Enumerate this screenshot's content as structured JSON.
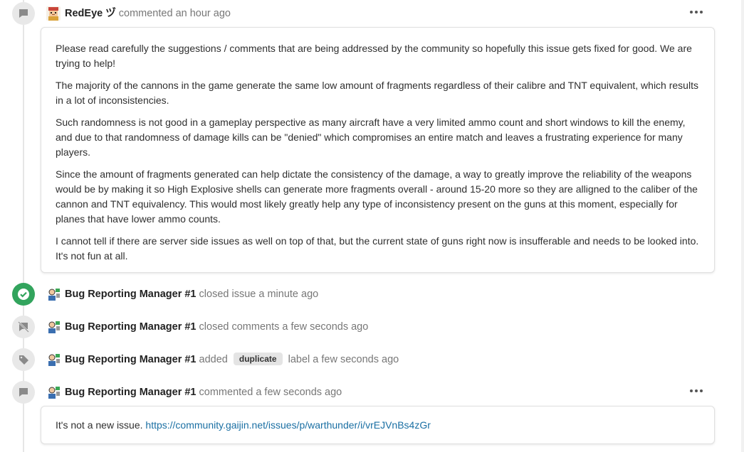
{
  "timeline": [
    {
      "type": "comment",
      "icon": "comment-icon",
      "author": "RedEye ヅ",
      "action": "commented",
      "time": "an hour ago",
      "paragraphs": [
        "Please read carefully the suggestions / comments that are being addressed by the community so hopefully this issue gets fixed for good. We are trying to help!",
        "The majority of the cannons in the game generate the same low amount of fragments regardless of their calibre and TNT equivalent, which results in a lot of inconsistencies.",
        "Such randomness is not good in a gameplay perspective as many aircraft have a very limited ammo count and short windows to kill the enemy, and due to that randomness of damage kills can be \"denied\" which compromises an entire match and leaves a frustrating experience for many players.",
        "Since the amount of fragments generated can help dictate the consistency of the damage, a way to greatly improve the reliability of the weapons would be by making it so High Explosive shells can generate more fragments overall - around 15-20 more so they are alligned to the caliber of the cannon and TNT equivalency. This would most likely greatly help any type of inconsistency present on the guns at this moment, especially for planes that have lower ammo counts.",
        "I cannot tell if there are server side issues as well on top of that, but the current state of guns right now is insufferable and needs to be looked into. It's not fun at all."
      ]
    },
    {
      "type": "event",
      "icon": "check-circle-icon",
      "author": "Bug Reporting Manager #1",
      "action": "closed issue",
      "time": "a minute ago"
    },
    {
      "type": "event",
      "icon": "comment-off-icon",
      "author": "Bug Reporting Manager #1",
      "action": "closed comments",
      "time": "a few seconds ago"
    },
    {
      "type": "event",
      "icon": "tag-icon",
      "author": "Bug Reporting Manager #1",
      "action": "added",
      "label": "duplicate",
      "action_after": "label",
      "time": "a few seconds ago"
    },
    {
      "type": "comment",
      "icon": "comment-icon",
      "author": "Bug Reporting Manager #1",
      "action": "commented",
      "time": "a few seconds ago",
      "body_text": "It's not a new issue.",
      "link": "https://community.gaijin.net/issues/p/warthunder/i/vrEJVnBs4zGr"
    }
  ],
  "colors": {
    "accent_link": "#1a6fa3",
    "closed_green": "#32a45d",
    "badge_gray": "#e8e8e8",
    "label_bg": "#e4e4e4"
  }
}
